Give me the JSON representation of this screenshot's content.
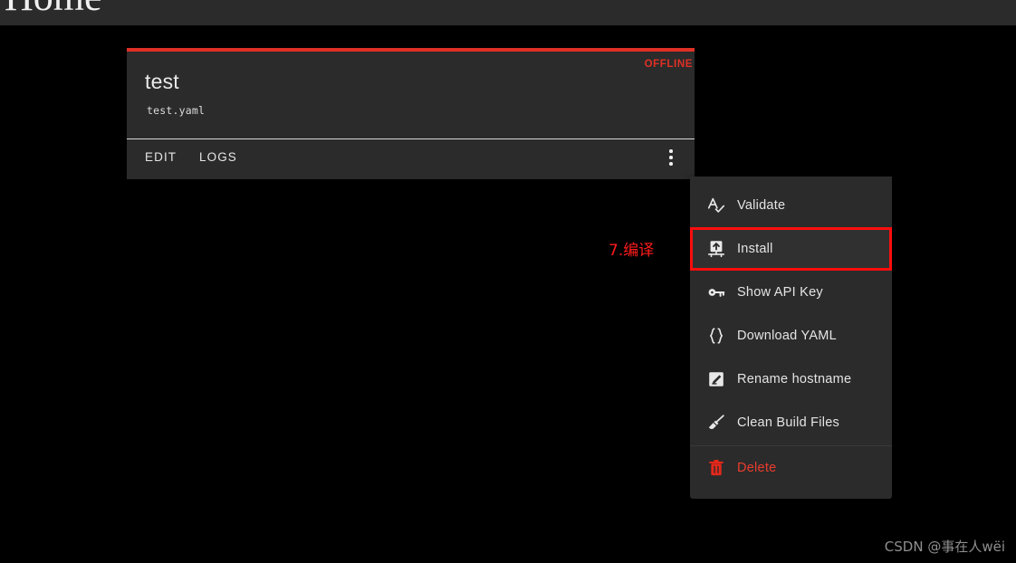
{
  "page": {
    "header_title": "Home",
    "background_color": "#000000",
    "surface_color": "#2b2b2b",
    "accent_color": "#e03026"
  },
  "card": {
    "name": "test",
    "filename": "test.yaml",
    "status": "OFFLINE",
    "status_color": "#e03026",
    "top_bar_color": "#e03026",
    "actions": {
      "edit_label": "EDIT",
      "logs_label": "LOGS",
      "more_icon": "kebab-menu-icon"
    }
  },
  "menu": {
    "items": [
      {
        "label": "Validate",
        "icon": "spellcheck-icon",
        "danger": false,
        "highlighted": false,
        "separator_before": false
      },
      {
        "label": "Install",
        "icon": "install-upload-icon",
        "danger": false,
        "highlighted": true,
        "separator_before": false
      },
      {
        "label": "Show API Key",
        "icon": "key-icon",
        "danger": false,
        "highlighted": false,
        "separator_before": false
      },
      {
        "label": "Download YAML",
        "icon": "braces-icon",
        "danger": false,
        "highlighted": false,
        "separator_before": false
      },
      {
        "label": "Rename hostname",
        "icon": "pencil-square-icon",
        "danger": false,
        "highlighted": false,
        "separator_before": false
      },
      {
        "label": "Clean Build Files",
        "icon": "broom-icon",
        "danger": false,
        "highlighted": false,
        "separator_before": false
      },
      {
        "label": "Delete",
        "icon": "trash-icon",
        "danger": true,
        "highlighted": false,
        "separator_before": true
      }
    ],
    "highlight_color": "#fb0d0d",
    "danger_color": "#ea3c2e"
  },
  "annotation": {
    "text": "7.编译",
    "color": "#ff1b1b"
  },
  "watermark": {
    "text": "CSDN @事在人wёi"
  }
}
